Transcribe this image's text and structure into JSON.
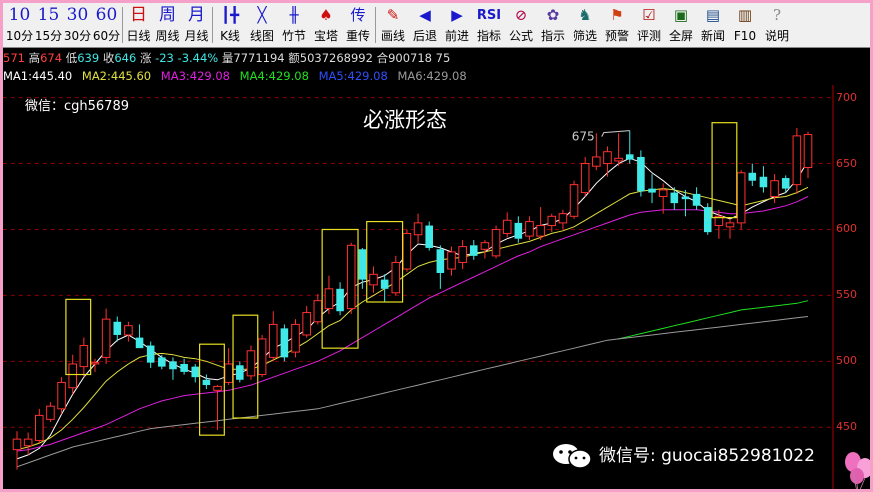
{
  "toolbar": {
    "items": [
      {
        "top": "10",
        "label": "10分",
        "color": "#1a1acc"
      },
      {
        "top": "15",
        "label": "15分",
        "color": "#1a1acc"
      },
      {
        "top": "30",
        "label": "30分",
        "color": "#1a1acc"
      },
      {
        "top": "60",
        "label": "60分",
        "color": "#1a1acc"
      },
      {
        "top": "日",
        "label": "日线",
        "color": "#d01010"
      },
      {
        "top": "周",
        "label": "周线",
        "color": "#1a1acc"
      },
      {
        "top": "月",
        "label": "月线",
        "color": "#1a1acc"
      },
      {
        "top": "┃╋",
        "label": "K线",
        "color": "#1a1acc",
        "icon": "candlestick-icon"
      },
      {
        "top": "╳",
        "label": "线图",
        "color": "#1a1acc",
        "icon": "line-chart-icon"
      },
      {
        "top": "╫",
        "label": "竹节",
        "color": "#1a1acc",
        "icon": "bamboo-icon"
      },
      {
        "top": "♠",
        "label": "宝塔",
        "color": "#d01010",
        "icon": "tower-icon"
      },
      {
        "top": "传",
        "label": "重传",
        "color": "#1a1acc",
        "icon": "reload-icon"
      },
      {
        "top": "✎",
        "label": "画线",
        "color": "#d01010",
        "icon": "pencil-icon"
      },
      {
        "top": "◀",
        "label": "后退",
        "color": "#1a1acc",
        "icon": "back-arrow-icon"
      },
      {
        "top": "▶",
        "label": "前进",
        "color": "#1a1acc",
        "icon": "forward-arrow-icon"
      },
      {
        "top": "RSI",
        "label": "指标",
        "color": "#1a1acc",
        "icon": "rsi-icon"
      },
      {
        "top": "⊘",
        "label": "公式",
        "color": "#b01050",
        "icon": "formula-icon"
      },
      {
        "top": "✿",
        "label": "指示",
        "color": "#5a3aa0",
        "icon": "indicator-icon"
      },
      {
        "top": "♞",
        "label": "筛选",
        "color": "#1a6a6a",
        "icon": "filter-icon"
      },
      {
        "top": "⚑",
        "label": "预警",
        "color": "#d04010",
        "icon": "alarm-icon"
      },
      {
        "top": "☑",
        "label": "评测",
        "color": "#b01010",
        "icon": "evaluate-icon"
      },
      {
        "top": "▣",
        "label": "全屏",
        "color": "#1a6a1a",
        "icon": "fullscreen-icon"
      },
      {
        "top": "▤",
        "label": "新闻",
        "color": "#1a4a8a",
        "icon": "news-icon"
      },
      {
        "top": "▥",
        "label": "F10",
        "color": "#6a3a10",
        "icon": "f10-icon"
      },
      {
        "top": "?",
        "label": "说明",
        "color": "#888888",
        "icon": "help-icon"
      }
    ]
  },
  "info": {
    "open": "571",
    "high_label": "高",
    "high": "674",
    "low_label": "低",
    "low": "639",
    "close_label": "收",
    "close": "646",
    "change_label": "涨",
    "change": "-23",
    "change_pct": "-3.44%",
    "volume_label": "量",
    "volume": "7771194",
    "amount_label": "额",
    "amount": "5037268992",
    "hold_label": "合",
    "hold": "900718",
    "extra": "75"
  },
  "ma": [
    {
      "label": "MA1:445.40",
      "color": "#ffffff"
    },
    {
      "label": "MA2:445.60",
      "color": "#e0e040"
    },
    {
      "label": "MA3:429.08",
      "color": "#e020e0"
    },
    {
      "label": "MA4:429.08",
      "color": "#20e020"
    },
    {
      "label": "MA5:429.08",
      "color": "#3050ff"
    },
    {
      "label": "MA6:429.08",
      "color": "#9a9a9a"
    }
  ],
  "watermark_top": "微信：cgh56789",
  "title": "必涨形态",
  "peak_label": "675",
  "watermark_bottom": "微信号: guocai852981022",
  "colors": {
    "up": "#ff3030",
    "down": "#40e8e8",
    "grid": "#8a0000",
    "box": "#e8e020"
  },
  "chart_data": {
    "type": "candlestick",
    "y_ticks": [
      450,
      500,
      550,
      600,
      650,
      700
    ],
    "ylim": [
      410,
      702
    ],
    "candles": [
      {
        "o": 433,
        "h": 447,
        "l": 418,
        "c": 441
      },
      {
        "o": 436,
        "h": 446,
        "l": 429,
        "c": 441
      },
      {
        "o": 440,
        "h": 464,
        "l": 438,
        "c": 459
      },
      {
        "o": 456,
        "h": 469,
        "l": 454,
        "c": 466
      },
      {
        "o": 464,
        "h": 488,
        "l": 460,
        "c": 484
      },
      {
        "o": 480,
        "h": 505,
        "l": 475,
        "c": 498
      },
      {
        "o": 496,
        "h": 518,
        "l": 488,
        "c": 512
      },
      {
        "o": 498,
        "h": 502,
        "l": 492,
        "c": 499
      },
      {
        "o": 503,
        "h": 540,
        "l": 498,
        "c": 532
      },
      {
        "o": 530,
        "h": 534,
        "l": 515,
        "c": 520
      },
      {
        "o": 520,
        "h": 530,
        "l": 515,
        "c": 527
      },
      {
        "o": 518,
        "h": 528,
        "l": 512,
        "c": 510
      },
      {
        "o": 512,
        "h": 515,
        "l": 495,
        "c": 499
      },
      {
        "o": 503,
        "h": 505,
        "l": 494,
        "c": 496
      },
      {
        "o": 500,
        "h": 503,
        "l": 486,
        "c": 494
      },
      {
        "o": 498,
        "h": 502,
        "l": 490,
        "c": 492
      },
      {
        "o": 496,
        "h": 498,
        "l": 484,
        "c": 488
      },
      {
        "o": 486,
        "h": 490,
        "l": 479,
        "c": 482
      },
      {
        "o": 478,
        "h": 482,
        "l": 448,
        "c": 481
      },
      {
        "o": 484,
        "h": 510,
        "l": 482,
        "c": 498
      },
      {
        "o": 497,
        "h": 500,
        "l": 484,
        "c": 486
      },
      {
        "o": 489,
        "h": 512,
        "l": 486,
        "c": 508
      },
      {
        "o": 490,
        "h": 520,
        "l": 488,
        "c": 517
      },
      {
        "o": 503,
        "h": 538,
        "l": 500,
        "c": 528
      },
      {
        "o": 525,
        "h": 528,
        "l": 500,
        "c": 503
      },
      {
        "o": 507,
        "h": 532,
        "l": 503,
        "c": 528
      },
      {
        "o": 520,
        "h": 542,
        "l": 518,
        "c": 537
      },
      {
        "o": 530,
        "h": 551,
        "l": 528,
        "c": 546
      },
      {
        "o": 540,
        "h": 565,
        "l": 536,
        "c": 555
      },
      {
        "o": 555,
        "h": 560,
        "l": 535,
        "c": 538
      },
      {
        "o": 540,
        "h": 590,
        "l": 536,
        "c": 588
      },
      {
        "o": 585,
        "h": 586,
        "l": 555,
        "c": 562
      },
      {
        "o": 558,
        "h": 572,
        "l": 552,
        "c": 566
      },
      {
        "o": 562,
        "h": 566,
        "l": 545,
        "c": 555
      },
      {
        "o": 552,
        "h": 580,
        "l": 550,
        "c": 575
      },
      {
        "o": 570,
        "h": 600,
        "l": 568,
        "c": 597
      },
      {
        "o": 596,
        "h": 612,
        "l": 590,
        "c": 605
      },
      {
        "o": 603,
        "h": 606,
        "l": 584,
        "c": 586
      },
      {
        "o": 585,
        "h": 588,
        "l": 555,
        "c": 567
      },
      {
        "o": 570,
        "h": 587,
        "l": 565,
        "c": 583
      },
      {
        "o": 575,
        "h": 592,
        "l": 570,
        "c": 587
      },
      {
        "o": 588,
        "h": 592,
        "l": 577,
        "c": 580
      },
      {
        "o": 585,
        "h": 592,
        "l": 578,
        "c": 590
      },
      {
        "o": 580,
        "h": 603,
        "l": 578,
        "c": 600
      },
      {
        "o": 597,
        "h": 613,
        "l": 594,
        "c": 607
      },
      {
        "o": 605,
        "h": 610,
        "l": 590,
        "c": 593
      },
      {
        "o": 595,
        "h": 610,
        "l": 592,
        "c": 606
      },
      {
        "o": 595,
        "h": 617,
        "l": 592,
        "c": 603
      },
      {
        "o": 603,
        "h": 612,
        "l": 598,
        "c": 610
      },
      {
        "o": 605,
        "h": 615,
        "l": 600,
        "c": 612
      },
      {
        "o": 610,
        "h": 637,
        "l": 608,
        "c": 634
      },
      {
        "o": 628,
        "h": 655,
        "l": 625,
        "c": 650
      },
      {
        "o": 648,
        "h": 673,
        "l": 645,
        "c": 655
      },
      {
        "o": 650,
        "h": 663,
        "l": 640,
        "c": 659
      },
      {
        "o": 652,
        "h": 673,
        "l": 648,
        "c": 654
      },
      {
        "o": 657,
        "h": 675,
        "l": 650,
        "c": 653
      },
      {
        "o": 655,
        "h": 660,
        "l": 625,
        "c": 629
      },
      {
        "o": 631,
        "h": 642,
        "l": 620,
        "c": 628
      },
      {
        "o": 625,
        "h": 635,
        "l": 612,
        "c": 630
      },
      {
        "o": 628,
        "h": 632,
        "l": 615,
        "c": 620
      },
      {
        "o": 625,
        "h": 630,
        "l": 610,
        "c": 623
      },
      {
        "o": 627,
        "h": 632,
        "l": 615,
        "c": 618
      },
      {
        "o": 617,
        "h": 620,
        "l": 596,
        "c": 598
      },
      {
        "o": 603,
        "h": 615,
        "l": 593,
        "c": 610
      },
      {
        "o": 602,
        "h": 608,
        "l": 593,
        "c": 605
      },
      {
        "o": 605,
        "h": 645,
        "l": 600,
        "c": 643
      },
      {
        "o": 643,
        "h": 650,
        "l": 633,
        "c": 637
      },
      {
        "o": 640,
        "h": 648,
        "l": 628,
        "c": 632
      },
      {
        "o": 625,
        "h": 642,
        "l": 620,
        "c": 637
      },
      {
        "o": 639,
        "h": 641,
        "l": 628,
        "c": 631
      },
      {
        "o": 634,
        "h": 677,
        "l": 627,
        "c": 671
      },
      {
        "o": 647,
        "h": 674,
        "l": 639,
        "c": 672
      }
    ],
    "ma_lines": [
      {
        "name": "MA1",
        "values": [
          426,
          429,
          434,
          444,
          460,
          475,
          488,
          498,
          508,
          516,
          520,
          515,
          509,
          503,
          498,
          494,
          491,
          487,
          486,
          489,
          491,
          495,
          502,
          510,
          514,
          519,
          524,
          533,
          540,
          545,
          556,
          560,
          562,
          565,
          571,
          581,
          589,
          588,
          586,
          583,
          580,
          582,
          583,
          589,
          593,
          596,
          599,
          603,
          605,
          608,
          616,
          625,
          635,
          643,
          650,
          654,
          651,
          643,
          637,
          630,
          625,
          621,
          614,
          611,
          608,
          612,
          617,
          621,
          625,
          628,
          638,
          652
        ]
      },
      {
        "name": "MA2",
        "values": [
          433,
          435,
          438,
          442,
          448,
          456,
          465,
          475,
          485,
          492,
          498,
          503,
          505,
          506,
          505,
          503,
          502,
          500,
          497,
          494,
          494,
          494,
          497,
          501,
          505,
          510,
          515,
          521,
          527,
          531,
          539,
          545,
          550,
          555,
          560,
          566,
          572,
          575,
          577,
          578,
          579,
          581,
          583,
          585,
          587,
          589,
          591,
          594,
          597,
          599,
          602,
          607,
          612,
          617,
          622,
          627,
          629,
          630,
          631,
          630,
          628,
          626,
          624,
          622,
          620,
          618,
          620,
          622,
          624,
          625,
          628,
          632
        ]
      },
      {
        "name": "MA3",
        "values": [
          432,
          433,
          435,
          437,
          440,
          443,
          446,
          449,
          452,
          456,
          460,
          464,
          467,
          470,
          472,
          474,
          475,
          476,
          477,
          478,
          480,
          482,
          485,
          488,
          491,
          494,
          497,
          500,
          504,
          508,
          513,
          518,
          523,
          528,
          533,
          538,
          543,
          548,
          552,
          556,
          560,
          564,
          568,
          572,
          576,
          580,
          583,
          587,
          590,
          593,
          596,
          599,
          602,
          605,
          608,
          611,
          613,
          614,
          615,
          615,
          615,
          615,
          614,
          613,
          612,
          612,
          613,
          614,
          616,
          618,
          621,
          625
        ]
      },
      {
        "name": "MA4",
        "startIndex": 54,
        "values": [
          517,
          519,
          521,
          523,
          525,
          527,
          529,
          531,
          533,
          535,
          537,
          539,
          540,
          541,
          542,
          543,
          544,
          546
        ]
      },
      {
        "name": "MA6",
        "values": [
          420,
          423,
          426,
          429,
          432,
          435,
          437,
          439,
          441,
          443,
          445,
          447,
          449,
          450,
          451,
          452,
          453,
          454,
          455,
          456,
          457,
          458,
          459,
          460,
          461,
          462,
          463,
          464,
          466,
          468,
          470,
          472,
          474,
          476,
          478,
          480,
          482,
          484,
          486,
          488,
          490,
          492,
          494,
          496,
          498,
          500,
          502,
          504,
          506,
          508,
          510,
          512,
          514,
          516,
          517,
          518,
          519,
          520,
          521,
          522,
          523,
          524,
          525,
          526,
          527,
          528,
          529,
          530,
          531,
          532,
          533,
          534
        ]
      }
    ],
    "highlight_boxes": [
      {
        "from": 5,
        "to": 6,
        "low": 490,
        "high": 547
      },
      {
        "from": 17,
        "to": 18,
        "low": 444,
        "high": 513
      },
      {
        "from": 20,
        "to": 21,
        "low": 457,
        "high": 535
      },
      {
        "from": 28,
        "to": 30,
        "low": 510,
        "high": 600
      },
      {
        "from": 32,
        "to": 34,
        "low": 545,
        "high": 606
      },
      {
        "from": 63,
        "to": 64,
        "low": 609,
        "high": 681
      }
    ]
  }
}
